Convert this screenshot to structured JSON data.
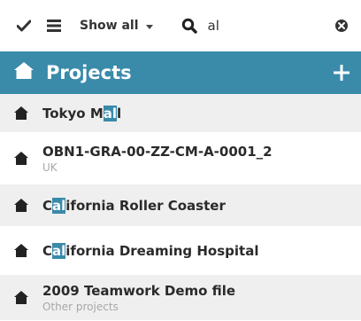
{
  "toolbar": {
    "show_all_label": "Show all",
    "search_value": "al"
  },
  "header": {
    "title": "Projects"
  },
  "projects": [
    {
      "pre": "Tokyo M",
      "hl": "al",
      "post": "l",
      "subtitle": ""
    },
    {
      "pre": "OBN1-GRA-00-ZZ-CM-A-0001_2",
      "hl": "",
      "post": "",
      "subtitle": "UK"
    },
    {
      "pre": "C",
      "hl": "al",
      "post": "ifornia Roller Coaster",
      "subtitle": ""
    },
    {
      "pre": "C",
      "hl": "al",
      "post": "ifornia Dreaming Hospital",
      "subtitle": ""
    },
    {
      "pre": "2009 Teamwork Demo file",
      "hl": "",
      "post": "",
      "subtitle": "Other projects"
    }
  ],
  "colors": {
    "accent": "#3a8aaa",
    "alt_row": "#efefef"
  },
  "icons": [
    "check-icon",
    "list-icon",
    "search-icon",
    "clear-icon",
    "home-icon",
    "plus-icon",
    "project-icon"
  ]
}
